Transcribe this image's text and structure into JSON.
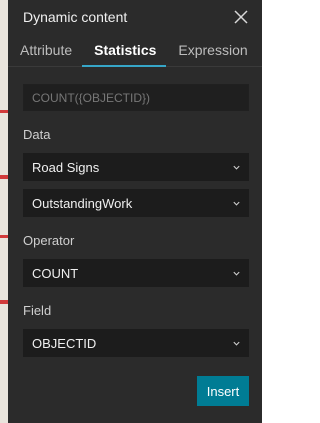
{
  "dialog": {
    "title": "Dynamic content"
  },
  "tabs": [
    {
      "label": "Attribute",
      "active": false
    },
    {
      "label": "Statistics",
      "active": true
    },
    {
      "label": "Expression",
      "active": false
    }
  ],
  "expression": {
    "placeholder": "COUNT({OBJECTID})"
  },
  "data_section": {
    "label": "Data",
    "layer_value": "Road Signs",
    "sublayer_value": "OutstandingWork"
  },
  "operator_section": {
    "label": "Operator",
    "value": "COUNT"
  },
  "field_section": {
    "label": "Field",
    "value": "OBJECTID"
  },
  "actions": {
    "insert_label": "Insert"
  },
  "colors": {
    "accent": "#36a6c8",
    "button": "#007c94",
    "panel": "#2b2b2b"
  },
  "icons": {
    "close": "close-icon",
    "dropdown": "chevron-down-icon"
  }
}
